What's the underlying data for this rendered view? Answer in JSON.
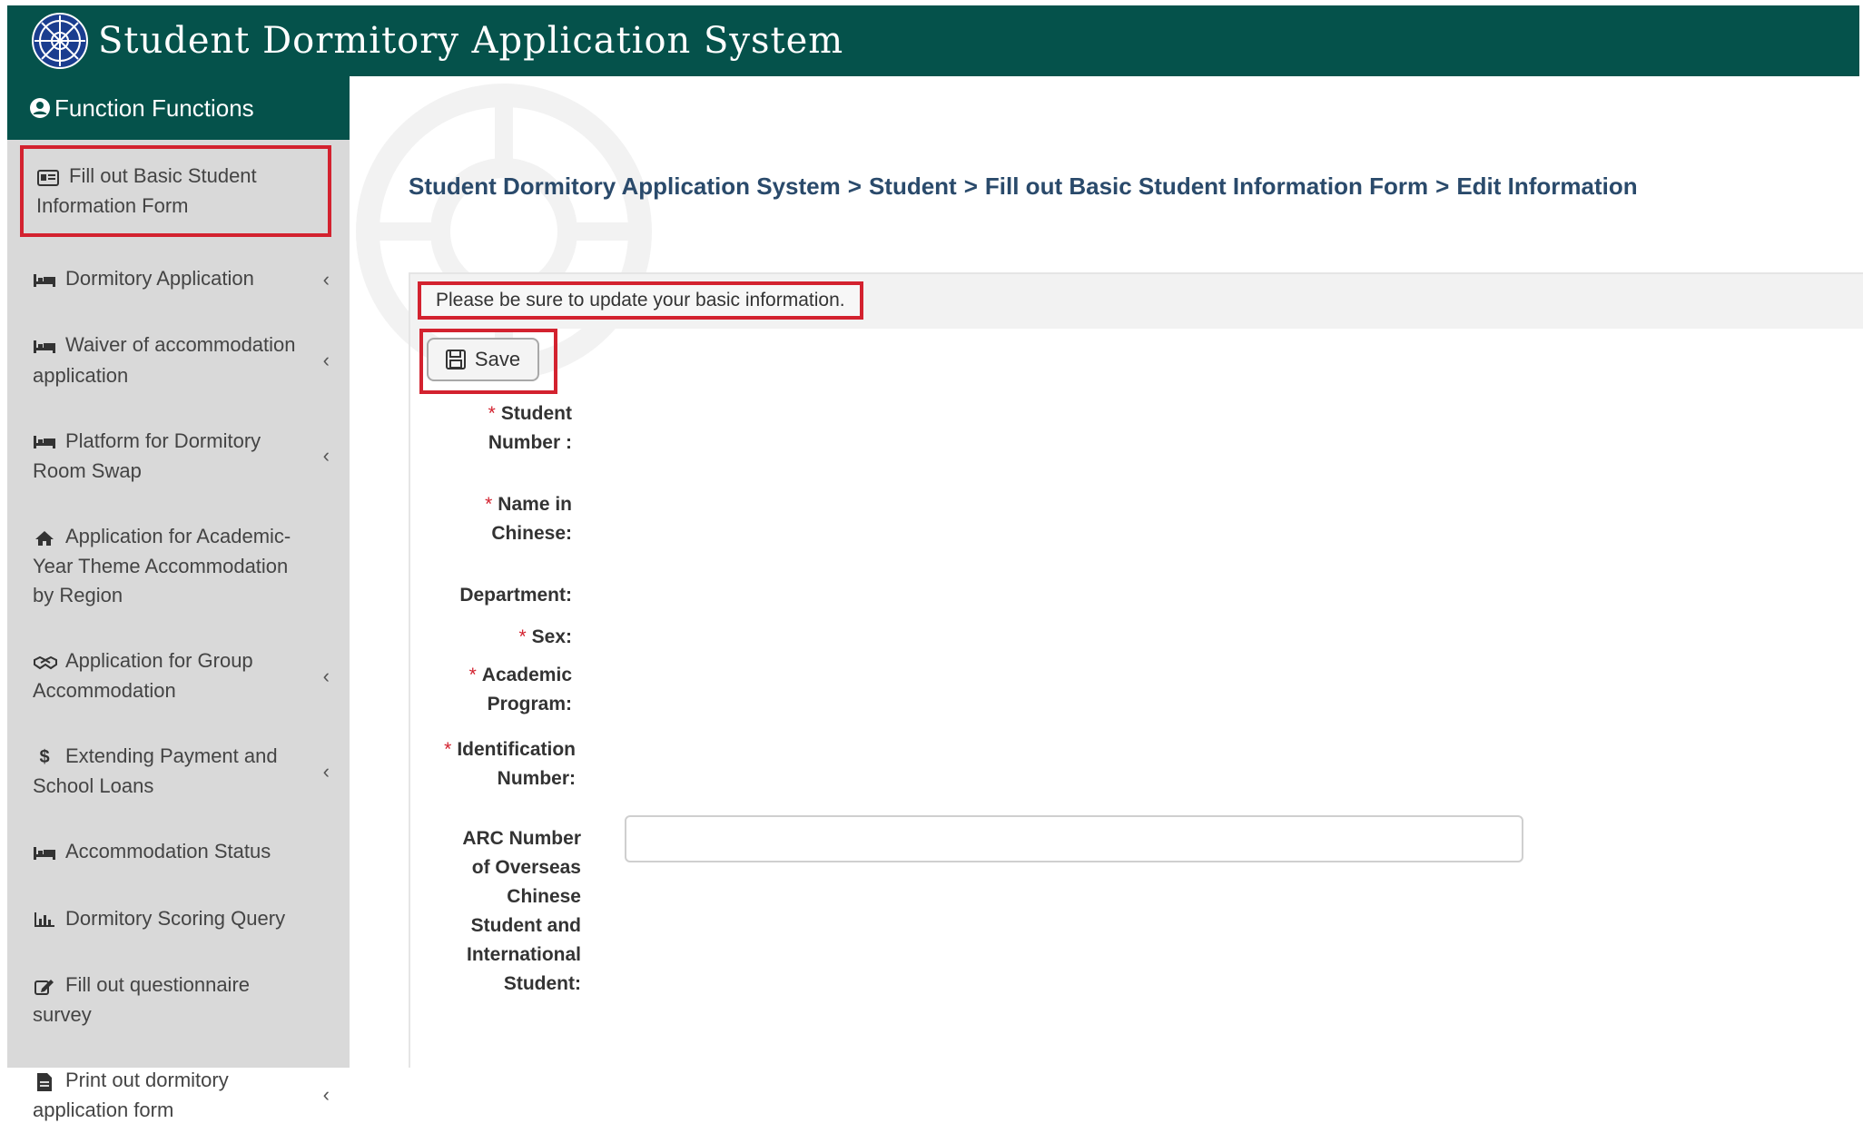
{
  "header": {
    "title": "Student Dormitory Application System"
  },
  "sidebar": {
    "heading": "Function Functions",
    "items": [
      {
        "label": "Fill out Basic Student Information Form",
        "icon": "id-card-icon",
        "has_chevron": false,
        "active": true
      },
      {
        "label": "Dormitory Application",
        "icon": "bed-icon",
        "has_chevron": true
      },
      {
        "label": "Waiver of accommodation application",
        "icon": "bed-icon",
        "has_chevron": true
      },
      {
        "label": "Platform for Dormitory Room Swap",
        "icon": "bed-icon",
        "has_chevron": true
      },
      {
        "label": "Application for Academic-Year Theme Accommodation by Region",
        "icon": "home-icon",
        "has_chevron": false
      },
      {
        "label": "Application for Group Accommodation",
        "icon": "handshake-icon",
        "has_chevron": true
      },
      {
        "label": "Extending Payment and School Loans",
        "icon": "dollar-icon",
        "has_chevron": true
      },
      {
        "label": "Accommodation Status",
        "icon": "bed-icon",
        "has_chevron": false
      },
      {
        "label": "Dormitory Scoring Query",
        "icon": "bar-chart-icon",
        "has_chevron": false
      },
      {
        "label": "Fill out questionnaire survey",
        "icon": "edit-icon",
        "has_chevron": false
      },
      {
        "label": "Print out dormitory application form",
        "icon": "file-icon",
        "has_chevron": true
      }
    ],
    "chevron": "‹"
  },
  "breadcrumb": {
    "items": [
      "Student Dormitory Application System",
      "Student",
      "Fill out Basic Student Information Form",
      "Edit Information"
    ],
    "separator": ">"
  },
  "notice": "Please be sure to update your basic information.",
  "toolbar": {
    "save_label": "Save"
  },
  "form": {
    "required_mark": "*",
    "fields": [
      {
        "label_line1": "Student",
        "label_line2": "Number :",
        "required": true
      },
      {
        "label_line1": "Name in",
        "label_line2": "Chinese:",
        "required": true
      },
      {
        "label_line1": "Department:",
        "required": false
      },
      {
        "label_line1": "Sex:",
        "required": true
      },
      {
        "label_line1": "Academic",
        "label_line2": "Program:",
        "required": true
      },
      {
        "label_line1": "Identification",
        "label_line2": "Number:",
        "required": true
      }
    ],
    "arc": {
      "lines": [
        "ARC Number",
        "of Overseas",
        "Chinese",
        "Student and",
        "International",
        "Student:"
      ],
      "value": ""
    }
  },
  "colors": {
    "header_bg": "#05524b",
    "highlight": "#d3222f",
    "sidebar_bg": "#d9d9d9"
  }
}
